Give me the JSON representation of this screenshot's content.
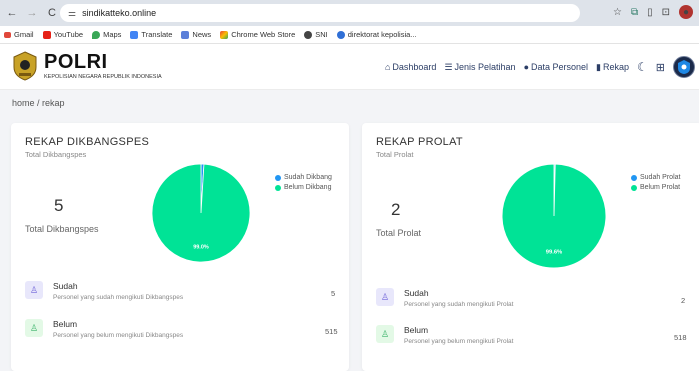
{
  "browser": {
    "url": "sindikatteko.online",
    "bookmarks": [
      "Gmail",
      "YouTube",
      "Maps",
      "Translate",
      "News",
      "Chrome Web Store",
      "SNI",
      "direktorat kepolisia..."
    ]
  },
  "app": {
    "logo_title": "POLRI",
    "logo_subtitle": "KEPOLISIAN NEGARA REPUBLIK INDONESIA",
    "menu": {
      "dashboard": "Dashboard",
      "jenis_pelatihan": "Jenis Pelatihan",
      "data_personel": "Data Personel",
      "rekap": "Rekap"
    },
    "breadcrumb": "home / rekap"
  },
  "cards": {
    "dik": {
      "title": "REKAP DIKBANGSPES",
      "subtitle": "Total Dikbangspes",
      "total": "5",
      "total_label": "Total Dikbangspes",
      "pie_label": "99.0%",
      "legend_sudah": "Sudah Dikbang",
      "legend_belum": "Belum Dikbang",
      "sudah_title": "Sudah",
      "sudah_desc": "Personel yang sudah mengikuti Dikbangspes",
      "sudah_value": "5",
      "belum_title": "Belum",
      "belum_desc": "Personel yang belum mengikuti Dikbangspes",
      "belum_value": "515"
    },
    "prolat": {
      "title": "REKAP PROLAT",
      "subtitle": "Total Prolat",
      "total": "2",
      "total_label": "Total Prolat",
      "pie_label": "99.6%",
      "legend_sudah": "Sudah Prolat",
      "legend_belum": "Belum Prolat",
      "sudah_title": "Sudah",
      "sudah_desc": "Personel yang sudah mengikuti Prolat",
      "sudah_value": "2",
      "belum_title": "Belum",
      "belum_desc": "Personel yang belum mengikuti Prolat",
      "belum_value": "518"
    }
  },
  "chart_data": [
    {
      "type": "pie",
      "categories": [
        "Sudah Dikbang",
        "Belum Dikbang"
      ],
      "values": [
        5,
        515
      ],
      "colors": [
        "#2196f3",
        "#00e396"
      ],
      "labels": [
        "",
        "99.0%"
      ]
    },
    {
      "type": "pie",
      "categories": [
        "Sudah Prolat",
        "Belum Prolat"
      ],
      "values": [
        2,
        518
      ],
      "colors": [
        "#2196f3",
        "#00e396"
      ],
      "labels": [
        "",
        "99.6%"
      ]
    }
  ],
  "colors": {
    "pie_sudah": "#2196f3",
    "pie_belum": "#00e396",
    "icon_sudah_bg": "#e8e7fb",
    "icon_belum_bg": "#e3f9e6"
  }
}
